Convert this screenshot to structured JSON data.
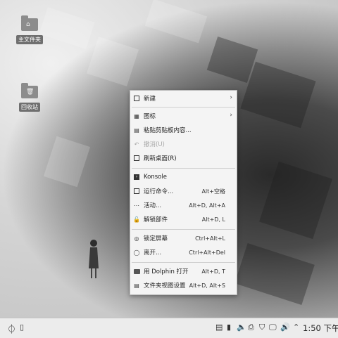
{
  "desktop": {
    "icons": [
      {
        "label": "主文件夹",
        "icon": "home-folder-icon",
        "symbol": "⌂"
      },
      {
        "label": "回收站",
        "icon": "trash-folder-icon",
        "symbol": "🗑"
      }
    ]
  },
  "context_menu": {
    "items": [
      {
        "label": "新建",
        "icon": "new-document-icon",
        "submenu": true
      },
      {
        "label": "图标",
        "icon": "view-icons-icon",
        "submenu": true
      },
      {
        "label": "粘贴剪贴板内容...",
        "icon": "clipboard-icon"
      },
      {
        "label": "撤消(U)",
        "icon": "undo-icon",
        "disabled": true
      },
      {
        "label": "刷新桌面(R)",
        "icon": "refresh-desktop-icon"
      },
      {
        "label": "Konsole",
        "icon": "terminal-icon"
      },
      {
        "label": "运行命令...",
        "shortcut": "Alt+空格",
        "icon": "run-command-icon"
      },
      {
        "label": "活动...",
        "shortcut": "Alt+D, Alt+A",
        "icon": "activities-icon"
      },
      {
        "label": "解锁部件",
        "shortcut": "Alt+D, L",
        "icon": "unlock-icon"
      },
      {
        "label": "锁定屏幕",
        "shortcut": "Ctrl+Alt+L",
        "icon": "lock-screen-icon"
      },
      {
        "label": "离开...",
        "shortcut": "Ctrl+Alt+Del",
        "icon": "leave-icon"
      },
      {
        "label": "用 Dolphin 打开",
        "shortcut": "Alt+D, T",
        "icon": "folder-open-icon"
      },
      {
        "label": "文件夹视图设置",
        "shortcut": "Alt+D, Alt+S",
        "icon": "folder-settings-icon"
      }
    ]
  },
  "taskbar": {
    "clock": "1:50 下午",
    "tray_icons": [
      "clipboard-icon",
      "battery-icon",
      "volume-icon",
      "printer-icon",
      "shield-icon",
      "network-icon",
      "speaker-icon",
      "chevron-up-icon"
    ]
  }
}
